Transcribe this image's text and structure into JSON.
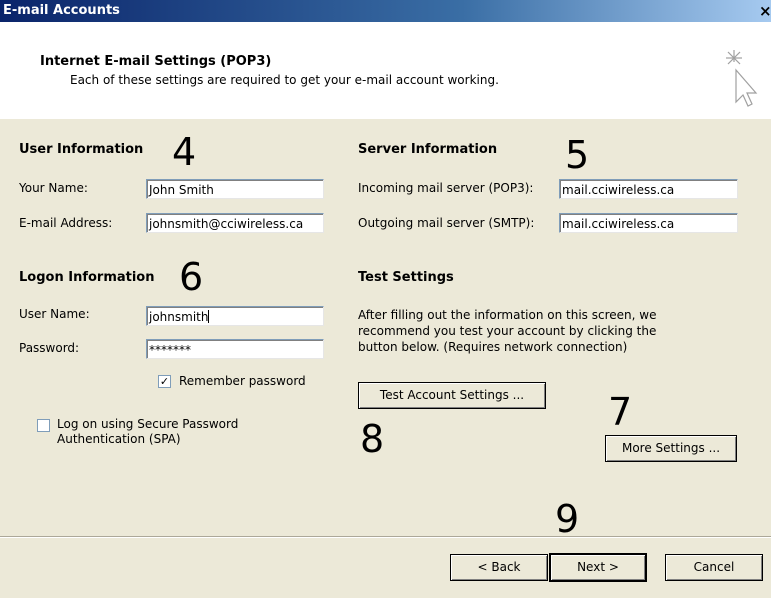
{
  "window": {
    "title": "E-mail Accounts",
    "close_label": "×"
  },
  "header": {
    "title": "Internet E-mail Settings (POP3)",
    "subtitle": "Each of these settings are required to get your e-mail account working."
  },
  "user_info": {
    "heading": "User Information",
    "name_label": "Your Name:",
    "name_value": "John Smith",
    "email_label": "E-mail Address:",
    "email_value": "johnsmith@cciwireless.ca"
  },
  "server_info": {
    "heading": "Server Information",
    "incoming_label": "Incoming mail server (POP3):",
    "incoming_value": "mail.cciwireless.ca",
    "outgoing_label": "Outgoing mail server (SMTP):",
    "outgoing_value": "mail.cciwireless.ca"
  },
  "logon_info": {
    "heading": "Logon Information",
    "username_label": "User Name:",
    "username_value": "johnsmith",
    "password_label": "Password:",
    "password_value": "*******",
    "remember_label": "Remember password",
    "remember_checked": true,
    "remember_mark": "✓",
    "spa_label_line1": "Log on using Secure Password",
    "spa_label_line2": "Authentication (SPA)",
    "spa_checked": false
  },
  "test_settings": {
    "heading": "Test Settings",
    "desc_line1": "After filling out the information on this screen, we",
    "desc_line2": "recommend you test your account by clicking the",
    "desc_line3": "button below. (Requires network connection)",
    "test_button": "Test Account Settings ...",
    "more_button": "More Settings ..."
  },
  "annotations": {
    "n4": "4",
    "n5": "5",
    "n6": "6",
    "n7": "7",
    "n8": "8",
    "n9": "9"
  },
  "footer": {
    "back": "< Back",
    "next": "Next >",
    "cancel": "Cancel"
  }
}
